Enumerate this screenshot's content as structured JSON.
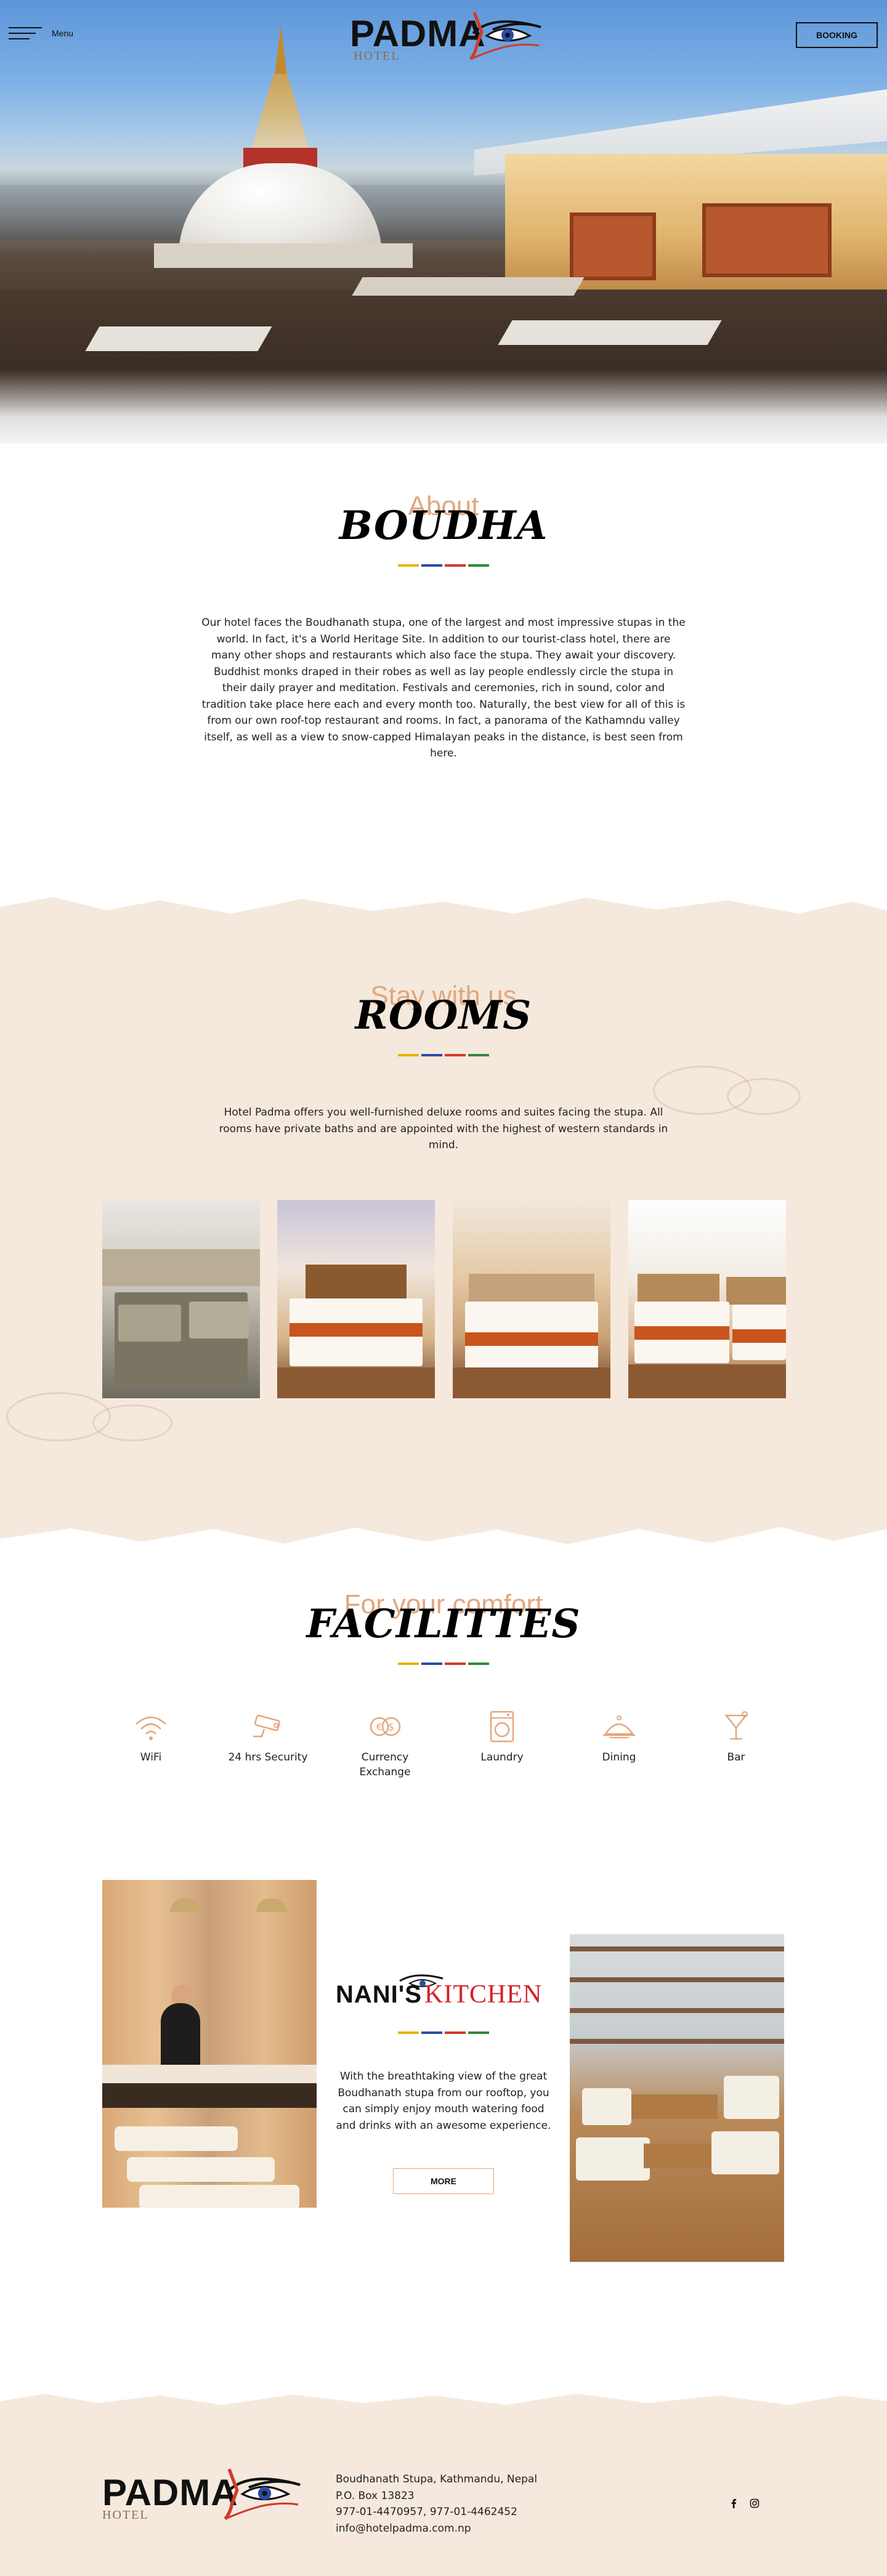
{
  "header": {
    "menu_label": "Menu",
    "logo_word": "PADMA",
    "logo_sub": "HOTEL",
    "booking_label": "BOOKING"
  },
  "about": {
    "kicker": "About",
    "title": "BOUDHA",
    "text": "Our hotel faces the Boudhanath stupa, one of the largest and most impressive stupas in the world. In fact, it's a World Heritage Site. In addition to our tourist-class hotel, there are many other shops and restaurants which also face the stupa. They await your discovery. Buddhist monks draped in their robes as well as lay people endlessly circle the stupa in their daily prayer and meditation. Festivals and ceremonies, rich in sound, color and tradition take place here each and every month too. Naturally, the best view for all of this is from our own roof-top restaurant and rooms. In fact, a panorama of the Kathamndu valley itself, as well as a view to snow-capped Himalayan peaks in the distance, is best seen from here."
  },
  "rooms": {
    "kicker": "Stay with us",
    "title": "ROOMS",
    "text": "Hotel Padma offers you well-furnished deluxe rooms and suites facing the stupa. All rooms have private baths and are appointed with the highest of western standards in mind."
  },
  "facilities": {
    "kicker": "For your comfort",
    "title": "FACILITTES",
    "items": [
      {
        "label": "WiFi",
        "icon": "wifi-icon"
      },
      {
        "label": "24 hrs Security",
        "icon": "cctv-icon"
      },
      {
        "label": "Currency Exchange",
        "icon": "currency-icon"
      },
      {
        "label": "Laundry",
        "icon": "washing-machine-icon"
      },
      {
        "label": "Dining",
        "icon": "dining-icon"
      },
      {
        "label": "Bar",
        "icon": "cocktail-icon"
      }
    ]
  },
  "kitchen": {
    "logo_nanis": "NANI'S",
    "logo_kitchen": "KITCHEN",
    "text": "With the breathtaking view of the great Boudhanath stupa from our rooftop, you can simply enjoy mouth watering food and drinks with an awesome experience.",
    "more_label": "MORE"
  },
  "footer": {
    "address": "Boudhanath Stupa, Kathmandu, Nepal",
    "po_box": "P.O. Box 13823",
    "phone": "977-01-4470957, 977-01-4462452",
    "email": "info@hotelpadma.com.np"
  },
  "colors": {
    "accent": "#e3a77d",
    "paper": "#f5e9de",
    "kitchen_red": "#d2232a",
    "divider": [
      "#e8b400",
      "#2a4ea6",
      "#d23a2a",
      "#2f8a3a"
    ]
  }
}
